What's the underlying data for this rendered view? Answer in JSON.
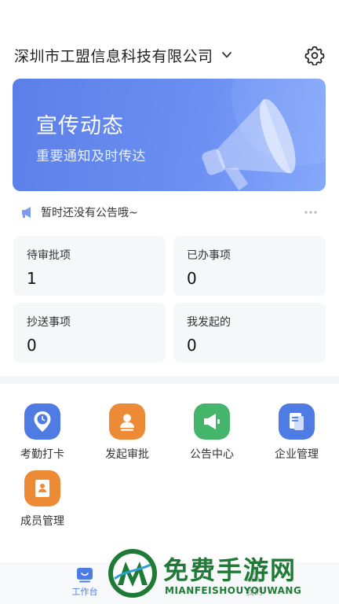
{
  "header": {
    "company_name": "深圳市工盟信息科技有限公司"
  },
  "banner": {
    "title": "宣传动态",
    "subtitle": "重要通知及时传达"
  },
  "notice": {
    "text": "暂时还没有公告哦~"
  },
  "stats": [
    {
      "label": "待审批项",
      "value": "1"
    },
    {
      "label": "已办事项",
      "value": "0"
    },
    {
      "label": "抄送事项",
      "value": "0"
    },
    {
      "label": "我发起的",
      "value": "0"
    }
  ],
  "apps": [
    {
      "label": "考勤打卡",
      "icon": "clock-location-icon",
      "color": "#4f7ce4"
    },
    {
      "label": "发起审批",
      "icon": "user-approval-icon",
      "color": "#ec8a35"
    },
    {
      "label": "公告中心",
      "icon": "megaphone-icon",
      "color": "#44b56b"
    },
    {
      "label": "企业管理",
      "icon": "document-icon",
      "color": "#4f7ce4"
    },
    {
      "label": "成员管理",
      "icon": "member-book-icon",
      "color": "#ec8a35"
    }
  ],
  "tabbar": {
    "tabs": [
      {
        "label": "工作台",
        "active": true
      },
      {
        "label": "我的",
        "active": false
      }
    ],
    "active_color": "#4f7ce4"
  },
  "watermark": {
    "title": "免费手游网",
    "subtitle": "MIANFEISHOUYOUWANG"
  }
}
